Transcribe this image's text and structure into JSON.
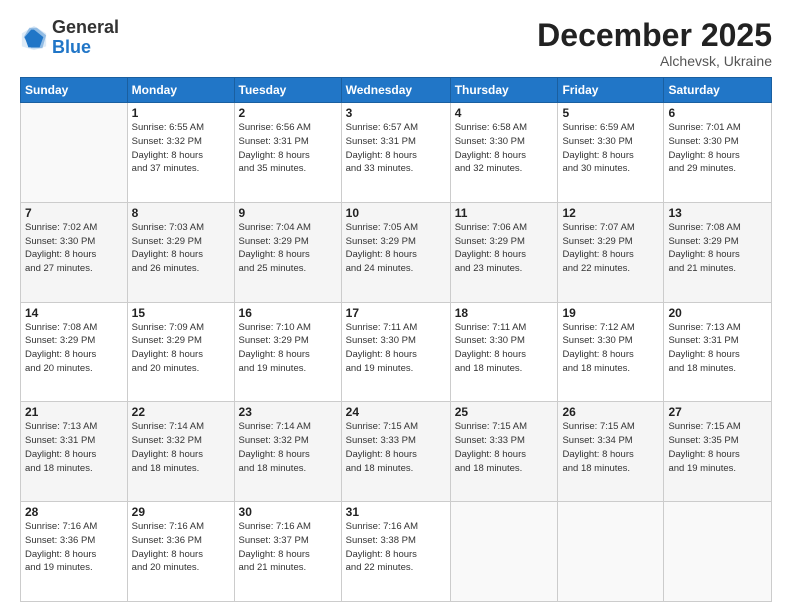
{
  "logo": {
    "general": "General",
    "blue": "Blue"
  },
  "header": {
    "month": "December 2025",
    "location": "Alchevsk, Ukraine"
  },
  "days_of_week": [
    "Sunday",
    "Monday",
    "Tuesday",
    "Wednesday",
    "Thursday",
    "Friday",
    "Saturday"
  ],
  "weeks": [
    [
      {
        "day": "",
        "info": ""
      },
      {
        "day": "1",
        "info": "Sunrise: 6:55 AM\nSunset: 3:32 PM\nDaylight: 8 hours\nand 37 minutes."
      },
      {
        "day": "2",
        "info": "Sunrise: 6:56 AM\nSunset: 3:31 PM\nDaylight: 8 hours\nand 35 minutes."
      },
      {
        "day": "3",
        "info": "Sunrise: 6:57 AM\nSunset: 3:31 PM\nDaylight: 8 hours\nand 33 minutes."
      },
      {
        "day": "4",
        "info": "Sunrise: 6:58 AM\nSunset: 3:30 PM\nDaylight: 8 hours\nand 32 minutes."
      },
      {
        "day": "5",
        "info": "Sunrise: 6:59 AM\nSunset: 3:30 PM\nDaylight: 8 hours\nand 30 minutes."
      },
      {
        "day": "6",
        "info": "Sunrise: 7:01 AM\nSunset: 3:30 PM\nDaylight: 8 hours\nand 29 minutes."
      }
    ],
    [
      {
        "day": "7",
        "info": "Sunrise: 7:02 AM\nSunset: 3:30 PM\nDaylight: 8 hours\nand 27 minutes."
      },
      {
        "day": "8",
        "info": "Sunrise: 7:03 AM\nSunset: 3:29 PM\nDaylight: 8 hours\nand 26 minutes."
      },
      {
        "day": "9",
        "info": "Sunrise: 7:04 AM\nSunset: 3:29 PM\nDaylight: 8 hours\nand 25 minutes."
      },
      {
        "day": "10",
        "info": "Sunrise: 7:05 AM\nSunset: 3:29 PM\nDaylight: 8 hours\nand 24 minutes."
      },
      {
        "day": "11",
        "info": "Sunrise: 7:06 AM\nSunset: 3:29 PM\nDaylight: 8 hours\nand 23 minutes."
      },
      {
        "day": "12",
        "info": "Sunrise: 7:07 AM\nSunset: 3:29 PM\nDaylight: 8 hours\nand 22 minutes."
      },
      {
        "day": "13",
        "info": "Sunrise: 7:08 AM\nSunset: 3:29 PM\nDaylight: 8 hours\nand 21 minutes."
      }
    ],
    [
      {
        "day": "14",
        "info": "Sunrise: 7:08 AM\nSunset: 3:29 PM\nDaylight: 8 hours\nand 20 minutes."
      },
      {
        "day": "15",
        "info": "Sunrise: 7:09 AM\nSunset: 3:29 PM\nDaylight: 8 hours\nand 20 minutes."
      },
      {
        "day": "16",
        "info": "Sunrise: 7:10 AM\nSunset: 3:29 PM\nDaylight: 8 hours\nand 19 minutes."
      },
      {
        "day": "17",
        "info": "Sunrise: 7:11 AM\nSunset: 3:30 PM\nDaylight: 8 hours\nand 19 minutes."
      },
      {
        "day": "18",
        "info": "Sunrise: 7:11 AM\nSunset: 3:30 PM\nDaylight: 8 hours\nand 18 minutes."
      },
      {
        "day": "19",
        "info": "Sunrise: 7:12 AM\nSunset: 3:30 PM\nDaylight: 8 hours\nand 18 minutes."
      },
      {
        "day": "20",
        "info": "Sunrise: 7:13 AM\nSunset: 3:31 PM\nDaylight: 8 hours\nand 18 minutes."
      }
    ],
    [
      {
        "day": "21",
        "info": "Sunrise: 7:13 AM\nSunset: 3:31 PM\nDaylight: 8 hours\nand 18 minutes."
      },
      {
        "day": "22",
        "info": "Sunrise: 7:14 AM\nSunset: 3:32 PM\nDaylight: 8 hours\nand 18 minutes."
      },
      {
        "day": "23",
        "info": "Sunrise: 7:14 AM\nSunset: 3:32 PM\nDaylight: 8 hours\nand 18 minutes."
      },
      {
        "day": "24",
        "info": "Sunrise: 7:15 AM\nSunset: 3:33 PM\nDaylight: 8 hours\nand 18 minutes."
      },
      {
        "day": "25",
        "info": "Sunrise: 7:15 AM\nSunset: 3:33 PM\nDaylight: 8 hours\nand 18 minutes."
      },
      {
        "day": "26",
        "info": "Sunrise: 7:15 AM\nSunset: 3:34 PM\nDaylight: 8 hours\nand 18 minutes."
      },
      {
        "day": "27",
        "info": "Sunrise: 7:15 AM\nSunset: 3:35 PM\nDaylight: 8 hours\nand 19 minutes."
      }
    ],
    [
      {
        "day": "28",
        "info": "Sunrise: 7:16 AM\nSunset: 3:36 PM\nDaylight: 8 hours\nand 19 minutes."
      },
      {
        "day": "29",
        "info": "Sunrise: 7:16 AM\nSunset: 3:36 PM\nDaylight: 8 hours\nand 20 minutes."
      },
      {
        "day": "30",
        "info": "Sunrise: 7:16 AM\nSunset: 3:37 PM\nDaylight: 8 hours\nand 21 minutes."
      },
      {
        "day": "31",
        "info": "Sunrise: 7:16 AM\nSunset: 3:38 PM\nDaylight: 8 hours\nand 22 minutes."
      },
      {
        "day": "",
        "info": ""
      },
      {
        "day": "",
        "info": ""
      },
      {
        "day": "",
        "info": ""
      }
    ]
  ]
}
